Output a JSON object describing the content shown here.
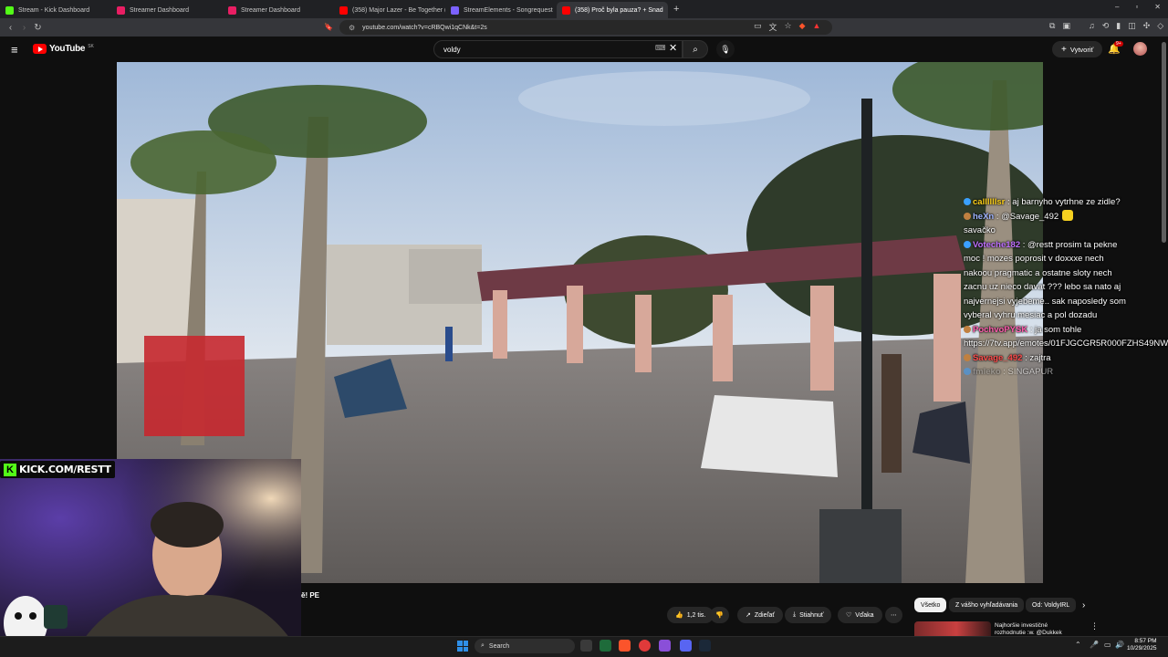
{
  "browser": {
    "tabs": [
      {
        "title": "Stream - Kick Dashboard",
        "fav": "#53fc18"
      },
      {
        "title": "Streamer Dashboard",
        "fav": "#e91e63"
      },
      {
        "title": "Streamer Dashboard",
        "fav": "#e91e63"
      },
      {
        "title": "(358) Major Lazer - Be Together (feat",
        "fav": "#ff0000"
      },
      {
        "title": "StreamElements - Songrequest",
        "fav": "#7b61ff"
      },
      {
        "title": "(358) Proč byla pauza? + Snad",
        "fav": "#ff0000",
        "active": true
      }
    ],
    "url": "youtube.com/watch?v=cRBQwi1qCNk&t=2s"
  },
  "youtube": {
    "logo_text": "YouTube",
    "region": "SK",
    "search_query": "voldy",
    "create_label": "Vytvoriť",
    "notif_badge": "9+"
  },
  "stream": {
    "kick_handle": "KICK.COM/RESTT",
    "chat": [
      {
        "user": "callllllsr",
        "color": "#ffd21a",
        "badge": "#3aa0ff",
        "text": ": aj barnyho vytrhne ze zidle?"
      },
      {
        "user": "heXn",
        "color": "#9fb4ff",
        "badge": "#c08040",
        "text": ": @Savage_492",
        "emote": "#f5d020",
        "text2": "savačko"
      },
      {
        "user": "Voteche182",
        "color": "#c070ff",
        "badge": "#3aa0ff",
        "text": ": @restt prosim ta pekne moc ! mozes poprosit v doxxxe nech nakoou pragmatic a ostatne sloty nech zacnu uz nieco davat ??? lebo sa nato aj najvernejsi vyjebeme.. sak naposledy som vyberal vyhru mesiac a pol dozadu"
      },
      {
        "user": "PochvoPYSK",
        "color": "#ff5cad",
        "badge": "#c08040",
        "text": ": ja som tohle https://7tv.app/emotes/01FJGCGR5R000FZHS49NWQS917"
      },
      {
        "user": "Savage_492",
        "color": "#ff4d4d",
        "badge": "#c08040",
        "text": ": zajtra"
      },
      {
        "user": "fmleko",
        "color": "#9a9a9a",
        "badge": "#3aa0ff",
        "text": ": SINGAPUR"
      }
    ]
  },
  "video": {
    "title_fragment": "ě! PE",
    "like_count": "1,2 tis.",
    "share_label": "Zdieľať",
    "download_label": "Stiahnuť",
    "thanks_label": "Vďaka"
  },
  "chips": [
    "Všetko",
    "Z vášho vyhľadávania",
    "Od: VoldyIRL"
  ],
  "recommended": {
    "title": "Najhoršie investičné rozhodnutie :w. @Dukkek"
  },
  "taskbar": {
    "search_label": "Search",
    "time": "8:57 PM",
    "date": "10/29/2025"
  }
}
